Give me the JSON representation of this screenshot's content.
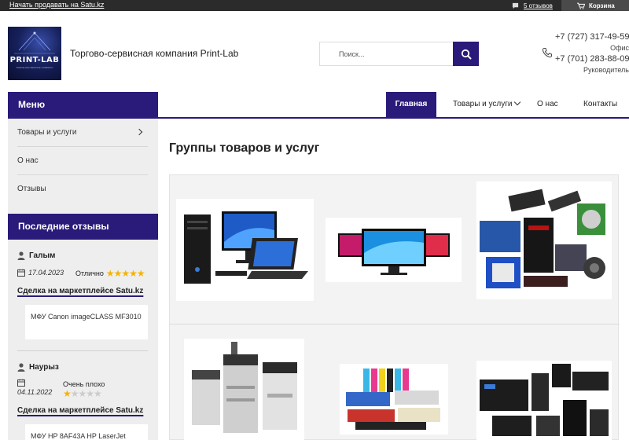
{
  "topbar": {
    "sell_link": "Начать продавать на Satu.kz",
    "reviews_link": "5 отзывов",
    "cart_label": "Корзина"
  },
  "header": {
    "logo_text": "PRINT-LAB",
    "logo_tagline": "TRADE AND SERVICE COMPANY",
    "company_name": "Торгово-сервисная компания Print-Lab",
    "search_placeholder": "Поиск...",
    "phones": [
      {
        "number": "+7 (727) 317-49-59",
        "label": "Офис"
      },
      {
        "number": "+7 (701) 283-88-09",
        "label": "Руководитель"
      }
    ]
  },
  "nav": {
    "menu_title": "Меню",
    "items": [
      {
        "label": "Главная",
        "active": true
      },
      {
        "label": "Товары и услуги",
        "has_dropdown": true
      },
      {
        "label": "О нас"
      },
      {
        "label": "Контакты"
      }
    ]
  },
  "sidebar": {
    "items": [
      {
        "label": "Товары и услуги",
        "has_arrow": true
      },
      {
        "label": "О нас"
      },
      {
        "label": "Отзывы"
      }
    ],
    "reviews_title": "Последние отзывы",
    "reviews": [
      {
        "name": "Галым",
        "date": "17.04.2023",
        "rating_label": "Отлично",
        "rating": 5,
        "deal_label": "Сделка на маркетплейсе Satu.kz",
        "product": "МФУ Canon imageCLASS MF3010"
      },
      {
        "name": "Наурыз",
        "date": "04.11.2022",
        "rating_label": "Очень плохо",
        "rating": 1,
        "deal_label": "Сделка на маркетплейсе Satu.kz",
        "product": "МФУ HP 8AF43A HP LaserJet"
      }
    ]
  },
  "main": {
    "title": "Группы товаров и услуг",
    "groups": [
      {
        "icon": "computers-image"
      },
      {
        "icon": "monitors-image"
      },
      {
        "icon": "components-image"
      },
      {
        "icon": "printers-image"
      },
      {
        "icon": "cartridges-image"
      },
      {
        "icon": "ups-image"
      }
    ]
  },
  "colors": {
    "brand": "#2a1a7a",
    "topbar": "#2b2b2b",
    "star": "#f5b400",
    "sidebar_bg": "#eeeeee"
  }
}
